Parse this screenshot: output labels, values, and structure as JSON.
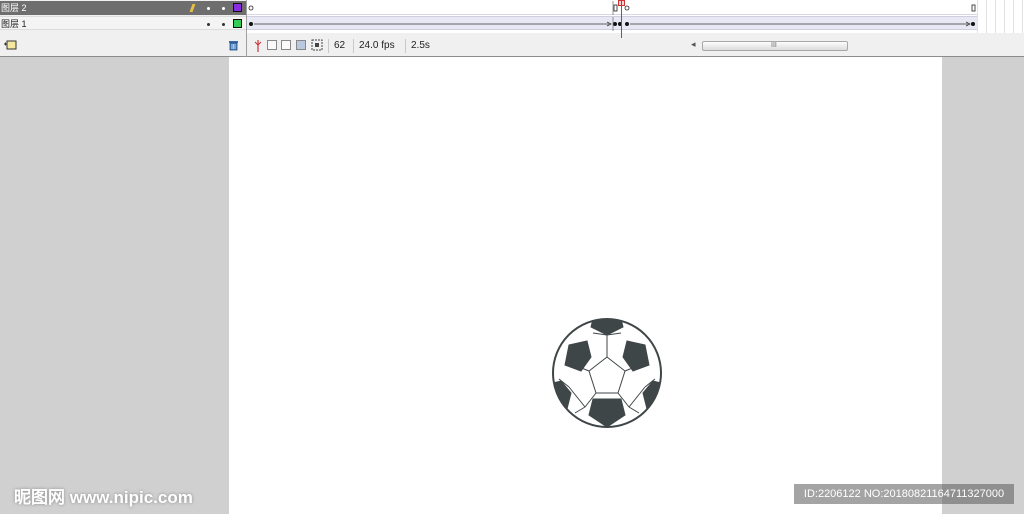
{
  "layers": [
    {
      "name": "图层 2",
      "selected": true,
      "color": "#8a2be2"
    },
    {
      "name": "图层 1",
      "selected": false,
      "color": "#33cc55"
    }
  ],
  "layer_toolbar": {
    "new_layer_icon": "add-layer-icon",
    "delete_icon": "trash-icon"
  },
  "frame_status": {
    "current_frame": "62",
    "frame_rate": "24.0 fps",
    "elapsed_time": "2.5s"
  },
  "scrollbar": {
    "grip": "III"
  },
  "watermark": {
    "left": "昵图网 www.nipic.com",
    "right": "ID:2206122 NO:20180821164711327000"
  },
  "colors": {
    "stage_bg": "#ffffff",
    "workspace_bg": "#d0d0d0",
    "ball_patch": "#3f4648",
    "playhead": "#cc3333"
  }
}
